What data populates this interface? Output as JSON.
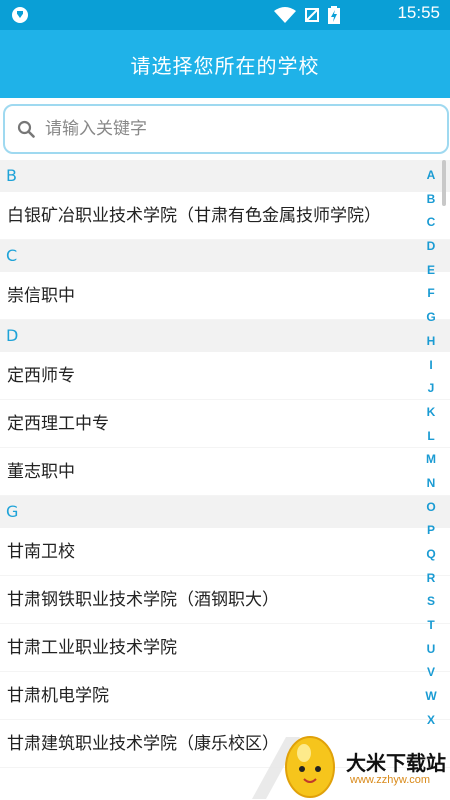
{
  "status_bar": {
    "time": "15:55",
    "icons": [
      "shield-icon",
      "wifi-icon",
      "no-sim-icon",
      "battery-icon"
    ]
  },
  "header": {
    "title": "请选择您所在的学校"
  },
  "search": {
    "placeholder": "请输入关键字",
    "value": ""
  },
  "sections": [
    {
      "letter": "B",
      "items": [
        "白银矿冶职业技术学院（甘肃有色金属技师学院）"
      ]
    },
    {
      "letter": "C",
      "items": [
        "崇信职中"
      ]
    },
    {
      "letter": "D",
      "items": [
        "定西师专",
        "定西理工中专",
        "董志职中"
      ]
    },
    {
      "letter": "G",
      "items": [
        "甘南卫校",
        "甘肃钢铁职业技术学院（酒钢职大）",
        "甘肃工业职业技术学院",
        "甘肃机电学院",
        "甘肃建筑职业技术学院（康乐校区）"
      ]
    }
  ],
  "index_letters": [
    "A",
    "B",
    "C",
    "D",
    "E",
    "F",
    "G",
    "H",
    "I",
    "J",
    "K",
    "L",
    "M",
    "N",
    "O",
    "P",
    "Q",
    "R",
    "S",
    "T",
    "U",
    "V",
    "W",
    "X"
  ],
  "watermark": {
    "name": "大米下载站",
    "url": "www.zzhyw.com"
  },
  "colors": {
    "status_bar": "#0a9fd6",
    "app_bar": "#1fb2e8",
    "accent": "#1fa3d8",
    "section_bg": "#f2f2f2"
  }
}
